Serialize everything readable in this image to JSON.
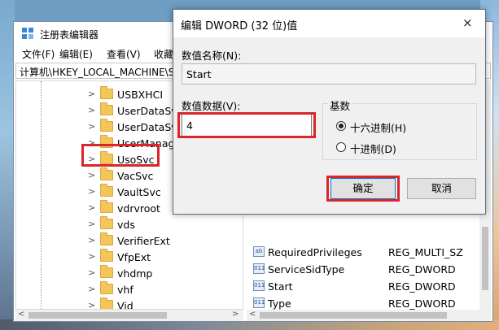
{
  "registry": {
    "title": "注册表编辑器",
    "menus": [
      "文件(F)",
      "编辑(E)",
      "查看(V)",
      "收藏"
    ],
    "address": "计算机\\HKEY_LOCAL_MACHINE\\S",
    "tree_items": [
      "USBXHCI",
      "UserDataSvc",
      "UserDataSvc",
      "UserManage",
      "UsoSvc",
      "VacSvc",
      "VaultSvc",
      "vdrvroot",
      "vds",
      "VerifierExt",
      "VfpExt",
      "vhdmp",
      "vhf",
      "Vid"
    ],
    "selected_item": "UsoSvc",
    "values": [
      {
        "name": "RequiredPrivileges",
        "type": "REG_MULTI_SZ",
        "icon": "ab"
      },
      {
        "name": "ServiceSidType",
        "type": "REG_DWORD",
        "icon": "011"
      },
      {
        "name": "Start",
        "type": "REG_DWORD",
        "icon": "011"
      },
      {
        "name": "Type",
        "type": "REG_DWORD",
        "icon": "011"
      }
    ]
  },
  "dialog": {
    "title": "编辑 DWORD (32 位)值",
    "close": "×",
    "value_name_label": "数值名称(N):",
    "value_name": "Start",
    "value_data_label": "数值数据(V):",
    "value_data": "4",
    "base_label": "基数",
    "hex_label": "十六进制(H)",
    "dec_label": "十进制(D)",
    "selected_base": "hex",
    "ok_label": "确定",
    "cancel_label": "取消"
  },
  "colors": {
    "highlight": "#d9262c",
    "folder": "#f4c65a",
    "dialog_bg": "#f0f0f0"
  }
}
